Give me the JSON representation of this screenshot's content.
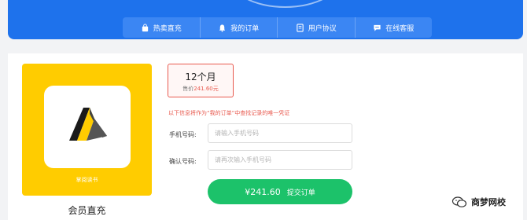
{
  "header": {
    "nav": [
      {
        "label": "热卖直充",
        "icon": "bag-icon"
      },
      {
        "label": "我的订单",
        "icon": "bell-icon"
      },
      {
        "label": "用户协议",
        "icon": "document-icon"
      },
      {
        "label": "在线客服",
        "icon": "chat-icon"
      }
    ]
  },
  "product": {
    "brand": "掌阅读书",
    "caption": "会员直充"
  },
  "plan": {
    "name": "12个月",
    "price_label": "售价",
    "price_value": "241.60元"
  },
  "notice": "以下信息将作为“我的订单”中查找记录的唯一凭证",
  "form": {
    "phone_label": "手机号码:",
    "phone_placeholder": "请输入手机号码",
    "confirm_label": "确认号码:",
    "confirm_placeholder": "请再次输入手机号码"
  },
  "submit": {
    "amount": "¥241.60",
    "label": "提交订单"
  },
  "watermark": "商梦网校",
  "colors": {
    "header_blue": "#1e72ec",
    "tile_yellow": "#ffcc00",
    "accent_red": "#e85a4f",
    "submit_green": "#1cc26a"
  }
}
